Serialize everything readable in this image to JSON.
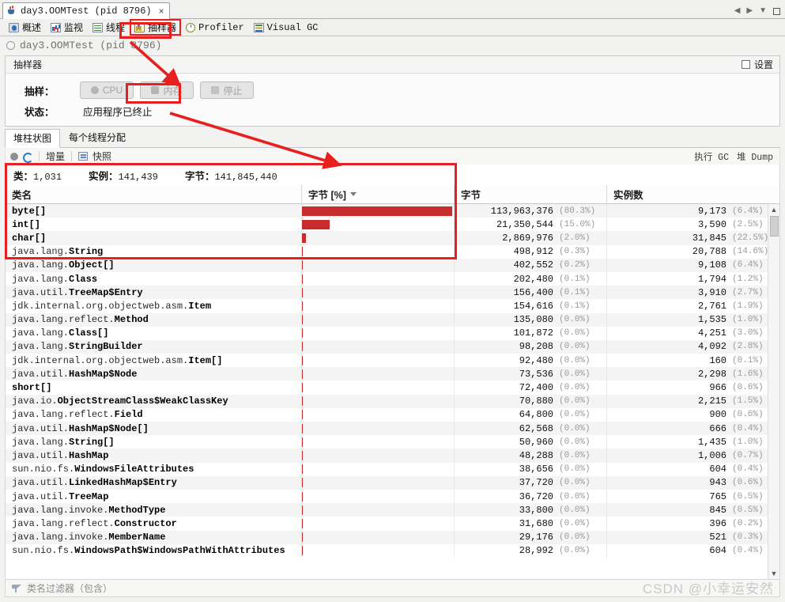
{
  "window": {
    "tab_title": "day3.OOMTest (pid 8796)",
    "tab_close": "×",
    "ctrl_prev": "◀",
    "ctrl_next": "▶",
    "ctrl_dropdown": "▼"
  },
  "view_tabs": [
    {
      "label": "概述",
      "icon": "overview-icon",
      "mono": false,
      "active": false
    },
    {
      "label": "监视",
      "icon": "monitor-icon",
      "mono": false,
      "active": false
    },
    {
      "label": "线程",
      "icon": "thread-icon",
      "mono": false,
      "active": false
    },
    {
      "label": "抽样器",
      "icon": "sampler-icon",
      "mono": false,
      "active": true
    },
    {
      "label": "Profiler",
      "icon": "profiler-icon",
      "mono": true,
      "active": false
    },
    {
      "label": "Visual GC",
      "icon": "visualgc-icon",
      "mono": true,
      "active": false
    }
  ],
  "app_header": {
    "title": "day3.OOMTest (pid 8796)"
  },
  "sampler_panel": {
    "title": "抽样器",
    "settings_label": "设置",
    "sampling_label": "抽样：",
    "buttons": [
      {
        "label": "CPU",
        "icon": "cpu-icon",
        "disabled": true,
        "highlighted": false
      },
      {
        "label": "内存",
        "icon": "memory-icon",
        "disabled": true,
        "highlighted": true
      },
      {
        "label": "停止",
        "icon": "stop-icon",
        "disabled": true,
        "highlighted": false
      }
    ],
    "status_label": "状态：",
    "status_value": "应用程序已终止"
  },
  "result_tabs": [
    {
      "label": "堆柱状图",
      "active": true
    },
    {
      "label": "每个线程分配",
      "active": false
    }
  ],
  "mini_toolbar": {
    "record_icon": "record-icon",
    "refresh_icon": "refresh-icon",
    "delta_label": "增量",
    "snapshot_icon": "snapshot-icon",
    "snapshot_label": "快照",
    "right_actions": [
      "执行 GC",
      "堆 Dump"
    ]
  },
  "summary": {
    "classes_label": "类：",
    "classes_value": "1,031",
    "instances_label": "实例：",
    "instances_value": "141,439",
    "bytes_label": "字节：",
    "bytes_value": "141,845,440"
  },
  "table": {
    "columns": [
      {
        "key": "class_name",
        "label": "类名",
        "sorted": false
      },
      {
        "key": "bytes_pct_bar",
        "label": "字节 [%]",
        "sorted": true,
        "sort_dir": "desc"
      },
      {
        "key": "bytes",
        "label": "字节",
        "sorted": false
      },
      {
        "key": "instances",
        "label": "实例数",
        "sorted": false
      }
    ],
    "rows": [
      {
        "pkg": "",
        "simple": "byte[]",
        "bytes": "113,963,376",
        "bytes_pct": "(80.3%)",
        "bar_pct": 80.3,
        "instances": "9,173",
        "inst_pct": "(6.4%)"
      },
      {
        "pkg": "",
        "simple": "int[]",
        "bytes": "21,350,544",
        "bytes_pct": "(15.0%)",
        "bar_pct": 15.0,
        "instances": "3,590",
        "inst_pct": "(2.5%)"
      },
      {
        "pkg": "",
        "simple": "char[]",
        "bytes": "2,869,976",
        "bytes_pct": "(2.0%)",
        "bar_pct": 2.0,
        "instances": "31,845",
        "inst_pct": "(22.5%)"
      },
      {
        "pkg": "java.lang.",
        "simple": "String",
        "bytes": "498,912",
        "bytes_pct": "(0.3%)",
        "bar_pct": 0.35,
        "instances": "20,788",
        "inst_pct": "(14.6%)"
      },
      {
        "pkg": "java.lang.",
        "simple": "Object[]",
        "bytes": "402,552",
        "bytes_pct": "(0.2%)",
        "bar_pct": 0.28,
        "instances": "9,108",
        "inst_pct": "(6.4%)"
      },
      {
        "pkg": "java.lang.",
        "simple": "Class",
        "bytes": "202,480",
        "bytes_pct": "(0.1%)",
        "bar_pct": 0.14,
        "instances": "1,794",
        "inst_pct": "(1.2%)"
      },
      {
        "pkg": "java.util.",
        "simple": "TreeMap$Entry",
        "bytes": "156,400",
        "bytes_pct": "(0.1%)",
        "bar_pct": 0.11,
        "instances": "3,910",
        "inst_pct": "(2.7%)"
      },
      {
        "pkg": "jdk.internal.org.objectweb.asm.",
        "simple": "Item",
        "bytes": "154,616",
        "bytes_pct": "(0.1%)",
        "bar_pct": 0.11,
        "instances": "2,761",
        "inst_pct": "(1.9%)"
      },
      {
        "pkg": "java.lang.reflect.",
        "simple": "Method",
        "bytes": "135,080",
        "bytes_pct": "(0.0%)",
        "bar_pct": 0.09,
        "instances": "1,535",
        "inst_pct": "(1.0%)"
      },
      {
        "pkg": "java.lang.",
        "simple": "Class[]",
        "bytes": "101,872",
        "bytes_pct": "(0.0%)",
        "bar_pct": 0.07,
        "instances": "4,251",
        "inst_pct": "(3.0%)"
      },
      {
        "pkg": "java.lang.",
        "simple": "StringBuilder",
        "bytes": "98,208",
        "bytes_pct": "(0.0%)",
        "bar_pct": 0.07,
        "instances": "4,092",
        "inst_pct": "(2.8%)"
      },
      {
        "pkg": "jdk.internal.org.objectweb.asm.",
        "simple": "Item[]",
        "bytes": "92,480",
        "bytes_pct": "(0.0%)",
        "bar_pct": 0.06,
        "instances": "160",
        "inst_pct": "(0.1%)"
      },
      {
        "pkg": "java.util.",
        "simple": "HashMap$Node",
        "bytes": "73,536",
        "bytes_pct": "(0.0%)",
        "bar_pct": 0.05,
        "instances": "2,298",
        "inst_pct": "(1.6%)"
      },
      {
        "pkg": "",
        "simple": "short[]",
        "bytes": "72,400",
        "bytes_pct": "(0.0%)",
        "bar_pct": 0.05,
        "instances": "966",
        "inst_pct": "(0.6%)"
      },
      {
        "pkg": "java.io.",
        "simple": "ObjectStreamClass$WeakClassKey",
        "bytes": "70,880",
        "bytes_pct": "(0.0%)",
        "bar_pct": 0.05,
        "instances": "2,215",
        "inst_pct": "(1.5%)"
      },
      {
        "pkg": "java.lang.reflect.",
        "simple": "Field",
        "bytes": "64,800",
        "bytes_pct": "(0.0%)",
        "bar_pct": 0.04,
        "instances": "900",
        "inst_pct": "(0.6%)"
      },
      {
        "pkg": "java.util.",
        "simple": "HashMap$Node[]",
        "bytes": "62,568",
        "bytes_pct": "(0.0%)",
        "bar_pct": 0.04,
        "instances": "666",
        "inst_pct": "(0.4%)"
      },
      {
        "pkg": "java.lang.",
        "simple": "String[]",
        "bytes": "50,960",
        "bytes_pct": "(0.0%)",
        "bar_pct": 0.035,
        "instances": "1,435",
        "inst_pct": "(1.0%)"
      },
      {
        "pkg": "java.util.",
        "simple": "HashMap",
        "bytes": "48,288",
        "bytes_pct": "(0.0%)",
        "bar_pct": 0.03,
        "instances": "1,006",
        "inst_pct": "(0.7%)"
      },
      {
        "pkg": "sun.nio.fs.",
        "simple": "WindowsFileAttributes",
        "bytes": "38,656",
        "bytes_pct": "(0.0%)",
        "bar_pct": 0.027,
        "instances": "604",
        "inst_pct": "(0.4%)"
      },
      {
        "pkg": "java.util.",
        "simple": "LinkedHashMap$Entry",
        "bytes": "37,720",
        "bytes_pct": "(0.0%)",
        "bar_pct": 0.026,
        "instances": "943",
        "inst_pct": "(0.6%)"
      },
      {
        "pkg": "java.util.",
        "simple": "TreeMap",
        "bytes": "36,720",
        "bytes_pct": "(0.0%)",
        "bar_pct": 0.025,
        "instances": "765",
        "inst_pct": "(0.5%)"
      },
      {
        "pkg": "java.lang.invoke.",
        "simple": "MethodType",
        "bytes": "33,800",
        "bytes_pct": "(0.0%)",
        "bar_pct": 0.023,
        "instances": "845",
        "inst_pct": "(0.5%)"
      },
      {
        "pkg": "java.lang.reflect.",
        "simple": "Constructor",
        "bytes": "31,680",
        "bytes_pct": "(0.0%)",
        "bar_pct": 0.022,
        "instances": "396",
        "inst_pct": "(0.2%)"
      },
      {
        "pkg": "java.lang.invoke.",
        "simple": "MemberName",
        "bytes": "29,176",
        "bytes_pct": "(0.0%)",
        "bar_pct": 0.02,
        "instances": "521",
        "inst_pct": "(0.3%)"
      },
      {
        "pkg": "sun.nio.fs.",
        "simple": "WindowsPath$WindowsPathWithAttributes",
        "bytes": "28,992",
        "bytes_pct": "(0.0%)",
        "bar_pct": 0.02,
        "instances": "604",
        "inst_pct": "(0.4%)"
      }
    ]
  },
  "filter": {
    "icon": "filter-icon",
    "placeholder": "类名过滤器（包含）"
  },
  "watermark": "CSDN @小幸运安然",
  "colors": {
    "bar": "#c62c2c",
    "annotation": "#e81f1f"
  }
}
